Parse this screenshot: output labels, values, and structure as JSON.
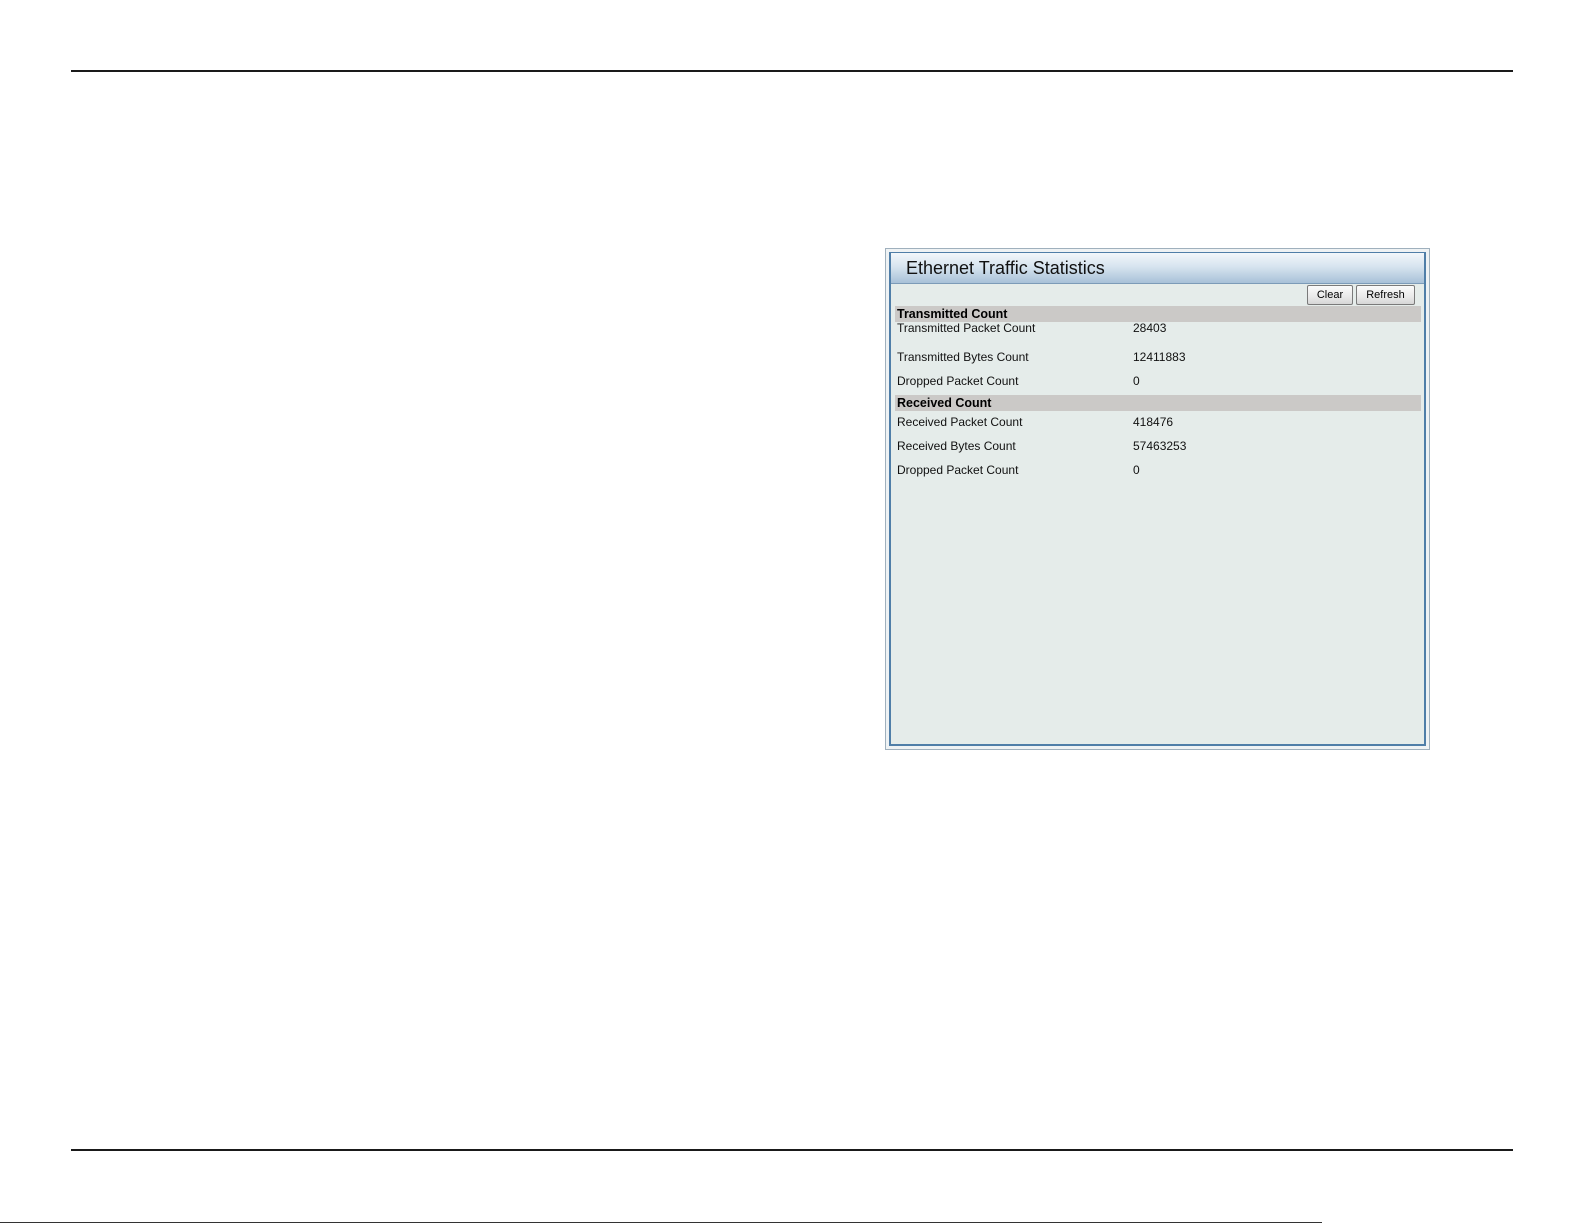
{
  "panel": {
    "title": "Ethernet Traffic Statistics",
    "buttons": {
      "clear": "Clear",
      "refresh": "Refresh"
    },
    "transmitted": {
      "header": "Transmitted Count",
      "rows": [
        {
          "label": "Transmitted Packet Count",
          "value": "28403"
        },
        {
          "label": "Transmitted Bytes Count",
          "value": "12411883"
        },
        {
          "label": "Dropped Packet Count",
          "value": "0"
        }
      ]
    },
    "received": {
      "header": "Received Count",
      "rows": [
        {
          "label": "Received Packet Count",
          "value": "418476"
        },
        {
          "label": "Received Bytes Count",
          "value": "57463253"
        },
        {
          "label": "Dropped Packet Count",
          "value": "0"
        }
      ]
    }
  },
  "colors": {
    "header_gradient_top": "#f2f7fb",
    "header_gradient_bottom": "#a8c1d8",
    "panel_border": "#4f7ea8",
    "panel_body": "#e5ecea",
    "section_header_bg": "#cbc9c7"
  }
}
